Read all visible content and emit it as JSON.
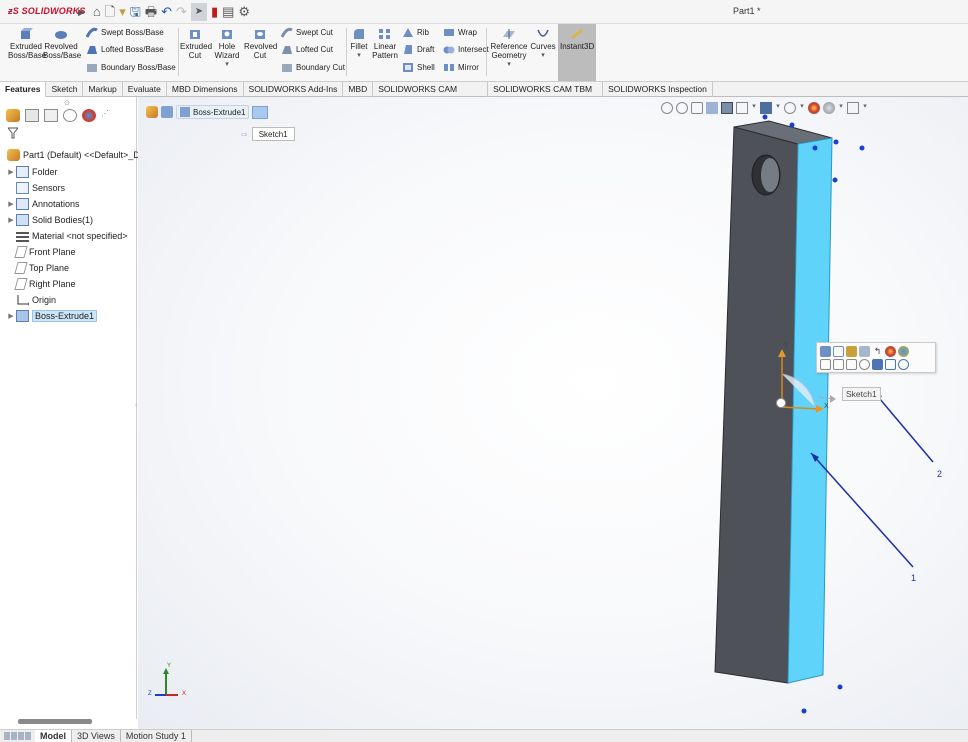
{
  "app": {
    "logo_text": "SOLIDWORKS",
    "document_title": "Part1 *"
  },
  "ribbon": {
    "extruded_boss": "Extruded\nBoss/Base",
    "revolved_boss": "Revolved\nBoss/Base",
    "swept_boss": "Swept Boss/Base",
    "lofted_boss": "Lofted Boss/Base",
    "boundary_boss": "Boundary Boss/Base",
    "extruded_cut": "Extruded\nCut",
    "hole_wizard": "Hole\nWizard",
    "revolved_cut": "Revolved\nCut",
    "swept_cut": "Swept Cut",
    "lofted_cut": "Lofted Cut",
    "boundary_cut": "Boundary Cut",
    "fillet": "Fillet",
    "linear_pattern": "Linear\nPattern",
    "rib": "Rib",
    "draft": "Draft",
    "shell": "Shell",
    "wrap": "Wrap",
    "intersect": "Intersect",
    "mirror": "Mirror",
    "reference_geometry": "Reference\nGeometry",
    "curves": "Curves",
    "instant3d": "Instant3D"
  },
  "command_tabs": [
    "Features",
    "Sketch",
    "Markup",
    "Evaluate",
    "MBD Dimensions",
    "SOLIDWORKS Add-Ins",
    "MBD",
    "SOLIDWORKS CAM",
    "SOLIDWORKS CAM TBM",
    "SOLIDWORKS Inspection"
  ],
  "feature_tree": {
    "root": "Part1 (Default) <<Default>_D",
    "items": [
      {
        "label": "Folder",
        "expandable": true
      },
      {
        "label": "Sensors",
        "expandable": false
      },
      {
        "label": "Annotations",
        "expandable": true
      },
      {
        "label": "Solid Bodies(1)",
        "expandable": true
      },
      {
        "label": "Material <not specified>",
        "expandable": false
      },
      {
        "label": "Front Plane",
        "expandable": false
      },
      {
        "label": "Top Plane",
        "expandable": false
      },
      {
        "label": "Right Plane",
        "expandable": false
      },
      {
        "label": "Origin",
        "expandable": false
      },
      {
        "label": "Boss-Extrude1",
        "expandable": true,
        "selected": true
      }
    ]
  },
  "viewport": {
    "breadcrumb_feature": "Boss-Extrude1",
    "breadcrumb_sketch": "Sketch1",
    "sketch_tag": "Sketch1",
    "axis_x": "X",
    "axis_y": "Y",
    "triad_x": "X",
    "triad_y": "Y",
    "triad_z": "Z",
    "annotation_1": "1",
    "annotation_2": "2"
  },
  "bottom_tabs": [
    "Model",
    "3D Views",
    "Motion Study 1"
  ],
  "colors": {
    "part_dark": "#4e5158",
    "part_highlight": "#5fd3fa",
    "accent_blue": "#1a2ea8",
    "ribbon_bg": "#f7f7f7"
  }
}
